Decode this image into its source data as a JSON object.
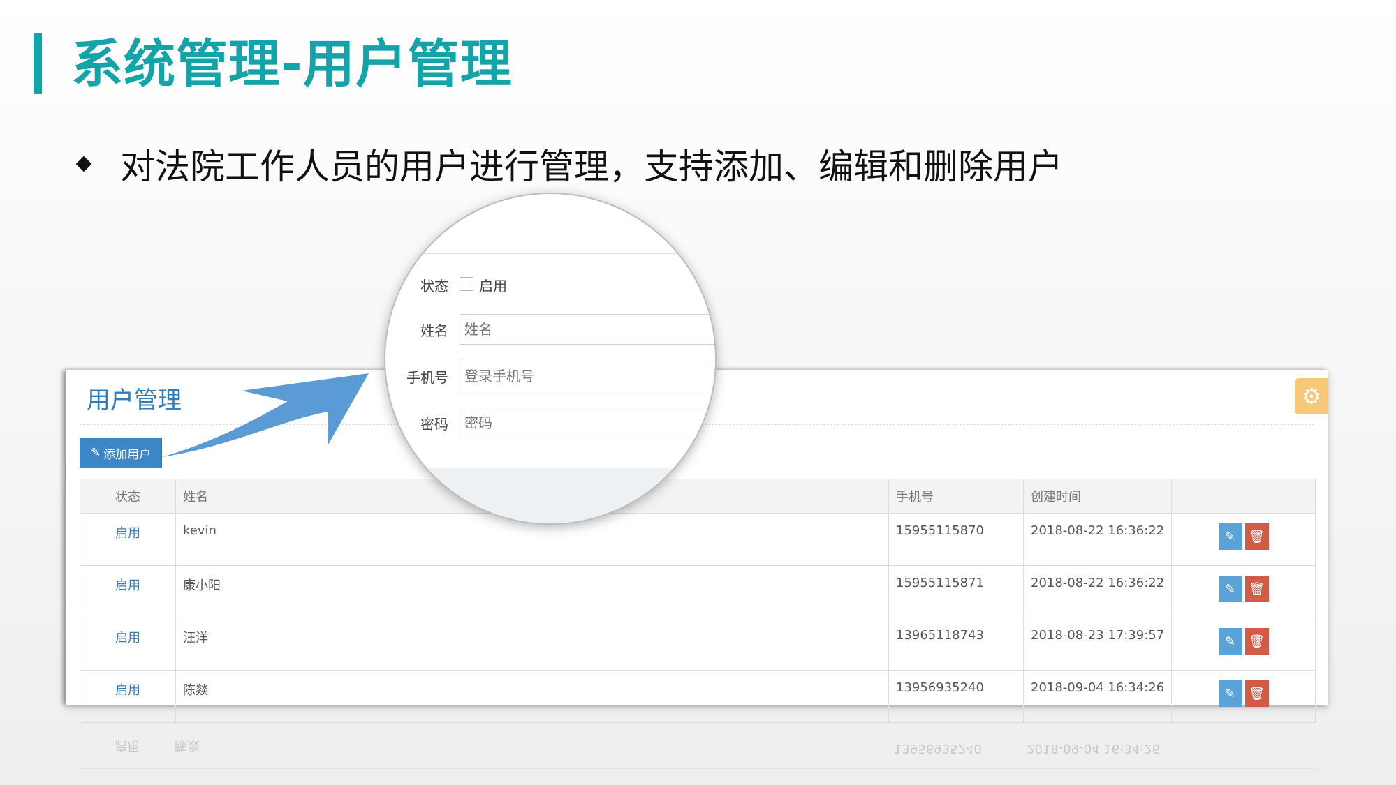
{
  "slide": {
    "title": "系统管理-用户管理",
    "bullet": "对法院工作人员的用户进行管理，支持添加、编辑和删除用户"
  },
  "panel": {
    "title": "用户管理",
    "add_button_label": "添加用户",
    "add_button_icon": "edit-icon",
    "settings_icon": "gear-icon"
  },
  "table": {
    "headers": [
      "状态",
      "姓名",
      "手机号",
      "创建时间",
      ""
    ],
    "rows": [
      {
        "status": "启用",
        "name": "kevin",
        "phone": "15955115870",
        "created": "2018-08-22 16:36:22"
      },
      {
        "status": "启用",
        "name": "康小阳",
        "phone": "15955115871",
        "created": "2018-08-22 16:36:22"
      },
      {
        "status": "启用",
        "name": "汪洋",
        "phone": "13965118743",
        "created": "2018-08-23 17:39:57"
      },
      {
        "status": "启用",
        "name": "陈燚",
        "phone": "13956935240",
        "created": "2018-09-04 16:34:26"
      }
    ],
    "row_actions": {
      "edit_icon": "pencil-icon",
      "delete_icon": "trash-icon"
    }
  },
  "form": {
    "status_label": "状态",
    "status_checkbox_label": "启用",
    "name_label": "姓名",
    "name_placeholder": "姓名",
    "phone_label": "手机号",
    "phone_placeholder": "登录手机号",
    "password_label": "密码",
    "password_placeholder": "密码"
  },
  "colors": {
    "title_teal": "#14a3a8",
    "panel_title_blue": "#2e7ebf",
    "add_button_blue": "#3d87c7",
    "edit_blue": "#5aa3d9",
    "delete_red": "#d15b47",
    "gear_orange": "#f7c877",
    "arrow_blue": "#5b9bd5"
  }
}
